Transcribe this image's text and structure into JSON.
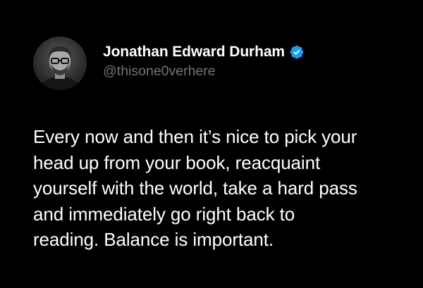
{
  "tweet": {
    "author": {
      "display_name": "Jonathan Edward Durham",
      "handle": "@thisone0verhere",
      "verified": true,
      "avatar": "avatar-photo-icon"
    },
    "text": "Every now and then it’s nice to pick your\nhead up from your book, reacquaint\nyourself with the world, take a hard pass\nand immediately go right back to\nreading. Balance is important."
  },
  "colors": {
    "background": "#000000",
    "name": "#ffffff",
    "handle": "#71767b",
    "text": "#ffffff",
    "verified_badge": "#1d9bf0"
  }
}
